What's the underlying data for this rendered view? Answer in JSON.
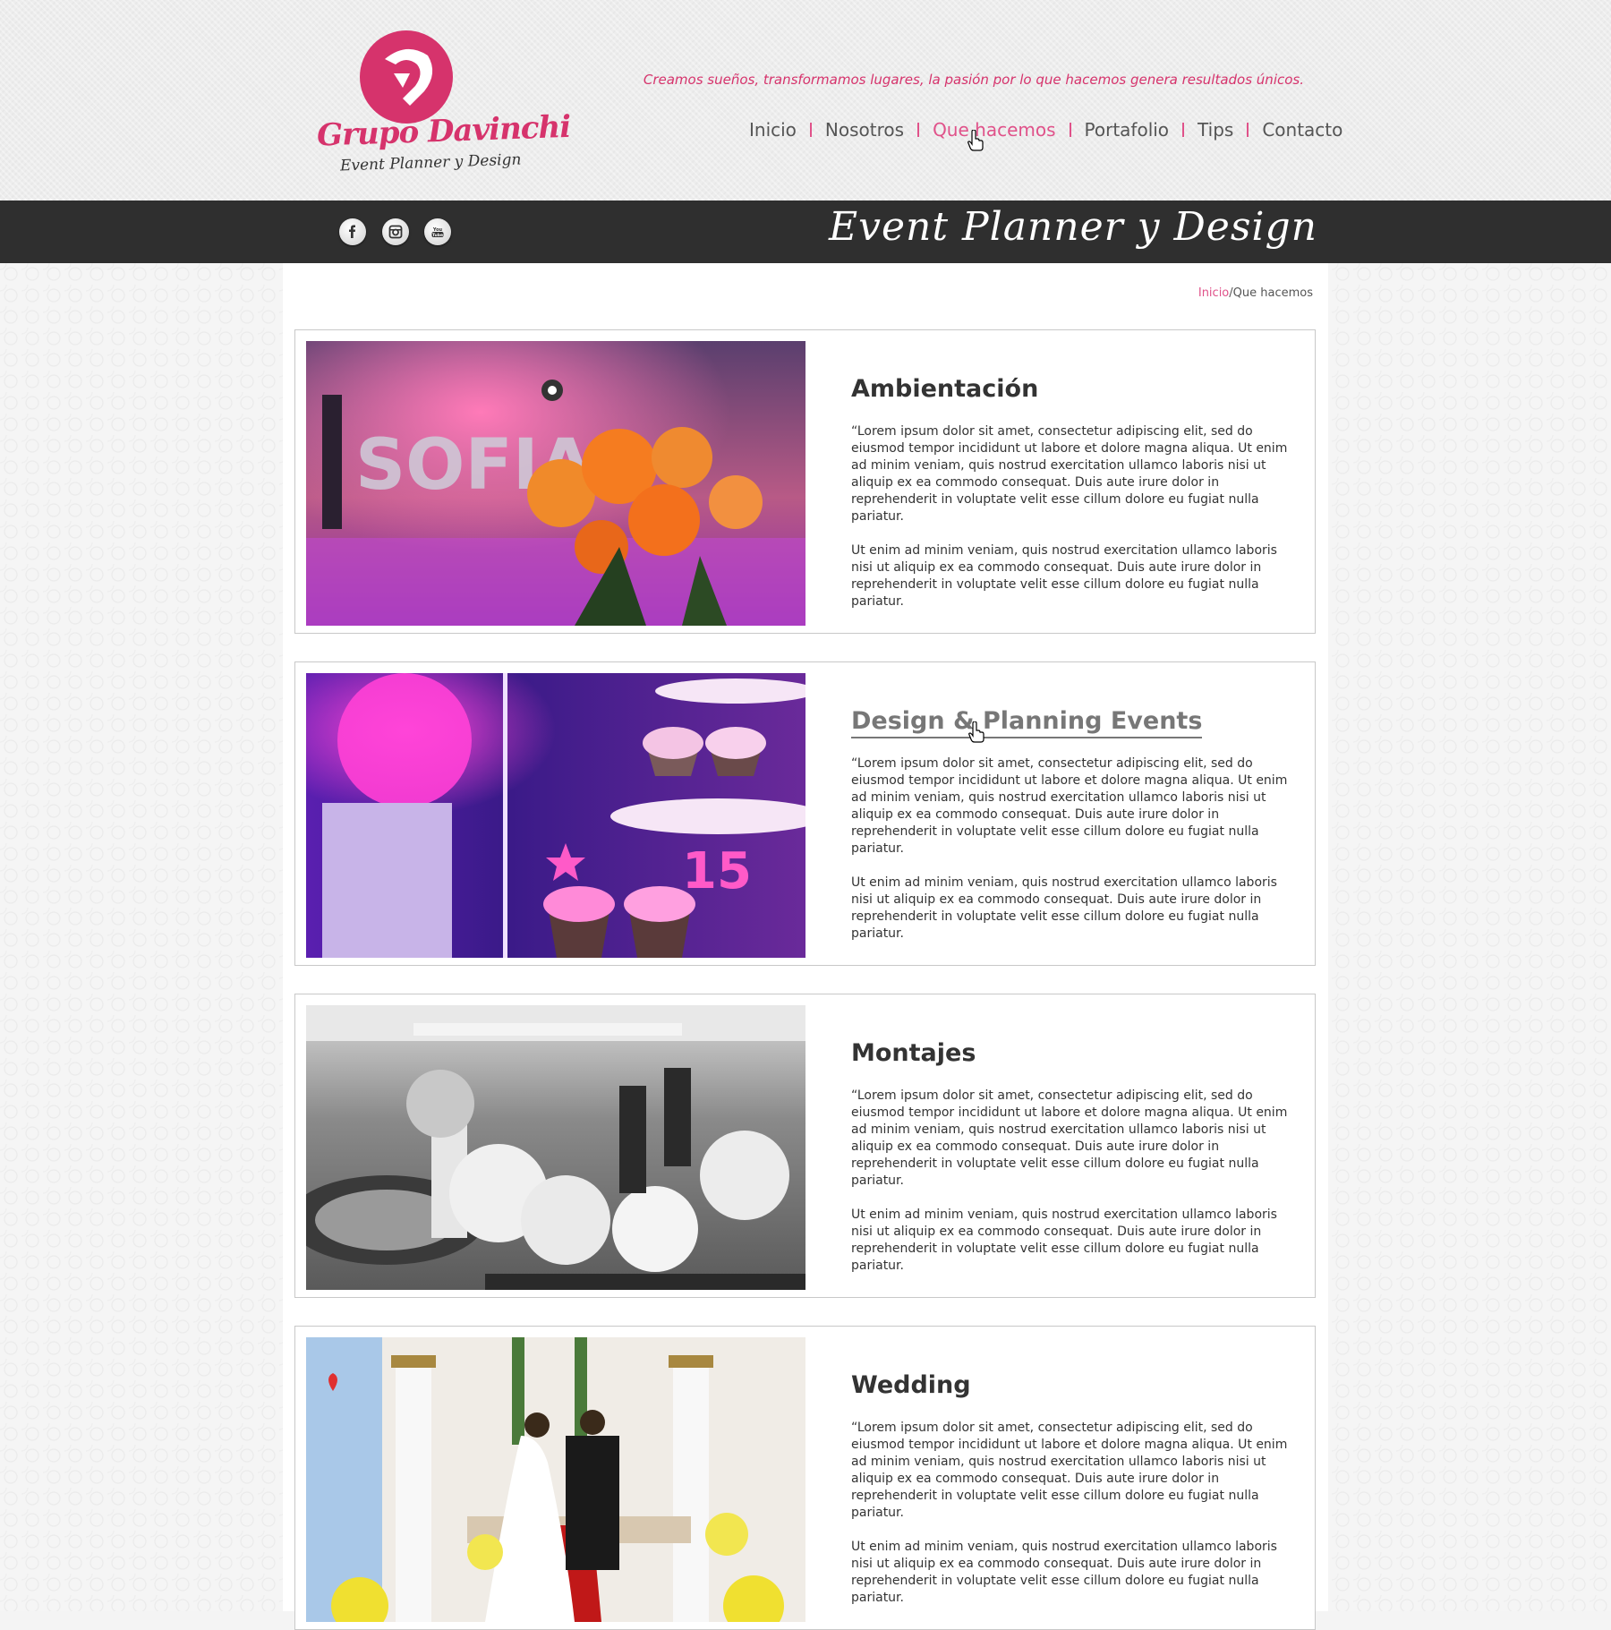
{
  "header": {
    "logo_name": "Grupo Davinchi",
    "logo_sub": "Event Planner y Design",
    "tagline": "Creamos sueños, transformamos lugares, la pasión por lo que hacemos genera resultados únicos.",
    "nav": [
      "Inicio",
      "Nosotros",
      "Que hacemos",
      "Portafolio",
      "Tips",
      "Contacto"
    ],
    "active_nav": "Que hacemos"
  },
  "bar": {
    "title": "Event Planner y Design",
    "social": [
      "facebook-icon",
      "instagram-icon",
      "youtube-icon"
    ]
  },
  "breadcrumb": {
    "home": "Inicio",
    "separator": "/",
    "current": "Que hacemos"
  },
  "services": [
    {
      "title": "Ambientación",
      "p1": "“Lorem ipsum dolor sit amet, consectetur adipiscing elit, sed do eiusmod tempor incididunt ut labore et dolore magna aliqua. Ut enim ad minim veniam, quis nostrud exercitation ullamco laboris nisi ut aliquip ex ea commodo consequat. Duis aute irure dolor in reprehenderit in voluptate velit esse cillum dolore eu fugiat nulla pariatur.",
      "p2": "Ut enim ad minim veniam, quis nostrud exercitation ullamco laboris nisi ut aliquip ex ea commodo consequat. Duis aute irure dolor in reprehenderit in voluptate velit esse cillum dolore eu fugiat nulla pariatur.",
      "photo_text": "SOFIA"
    },
    {
      "title": "Design & Planning Events",
      "p1": "“Lorem ipsum dolor sit amet, consectetur adipiscing elit, sed do eiusmod tempor incididunt ut labore et dolore magna aliqua. Ut enim ad minim veniam, quis nostrud exercitation ullamco laboris nisi ut aliquip ex ea commodo consequat. Duis aute irure dolor in reprehenderit in voluptate velit esse cillum dolore eu fugiat nulla pariatur.",
      "p2": "Ut enim ad minim veniam, quis nostrud exercitation ullamco laboris nisi ut aliquip ex ea commodo consequat. Duis aute irure dolor in reprehenderit in voluptate velit esse cillum dolore eu fugiat nulla pariatur.",
      "photo_text": "15"
    },
    {
      "title": "Montajes",
      "p1": "“Lorem ipsum dolor sit amet, consectetur adipiscing elit, sed do eiusmod tempor incididunt ut labore et dolore magna aliqua. Ut enim ad minim veniam, quis nostrud exercitation ullamco laboris nisi ut aliquip ex ea commodo consequat. Duis aute irure dolor in reprehenderit in voluptate velit esse cillum dolore eu fugiat nulla pariatur.",
      "p2": "Ut enim ad minim veniam, quis nostrud exercitation ullamco laboris nisi ut aliquip ex ea commodo consequat. Duis aute irure dolor in reprehenderit in voluptate velit esse cillum dolore eu fugiat nulla pariatur."
    },
    {
      "title": "Wedding",
      "p1": "“Lorem ipsum dolor sit amet, consectetur adipiscing elit, sed do eiusmod tempor incididunt ut labore et dolore magna aliqua. Ut enim ad minim veniam, quis nostrud exercitation ullamco laboris nisi ut aliquip ex ea commodo consequat. Duis aute irure dolor in reprehenderit in voluptate velit esse cillum dolore eu fugiat nulla pariatur.",
      "p2": "Ut enim ad minim veniam, quis nostrud exercitation ullamco laboris nisi ut aliquip ex ea commodo consequat. Duis aute irure dolor in reprehenderit in voluptate velit esse cillum dolore eu fugiat nulla pariatur."
    }
  ],
  "colors": {
    "accent": "#e0528a",
    "dark_bar": "#2f2f2f",
    "text": "#333333"
  }
}
